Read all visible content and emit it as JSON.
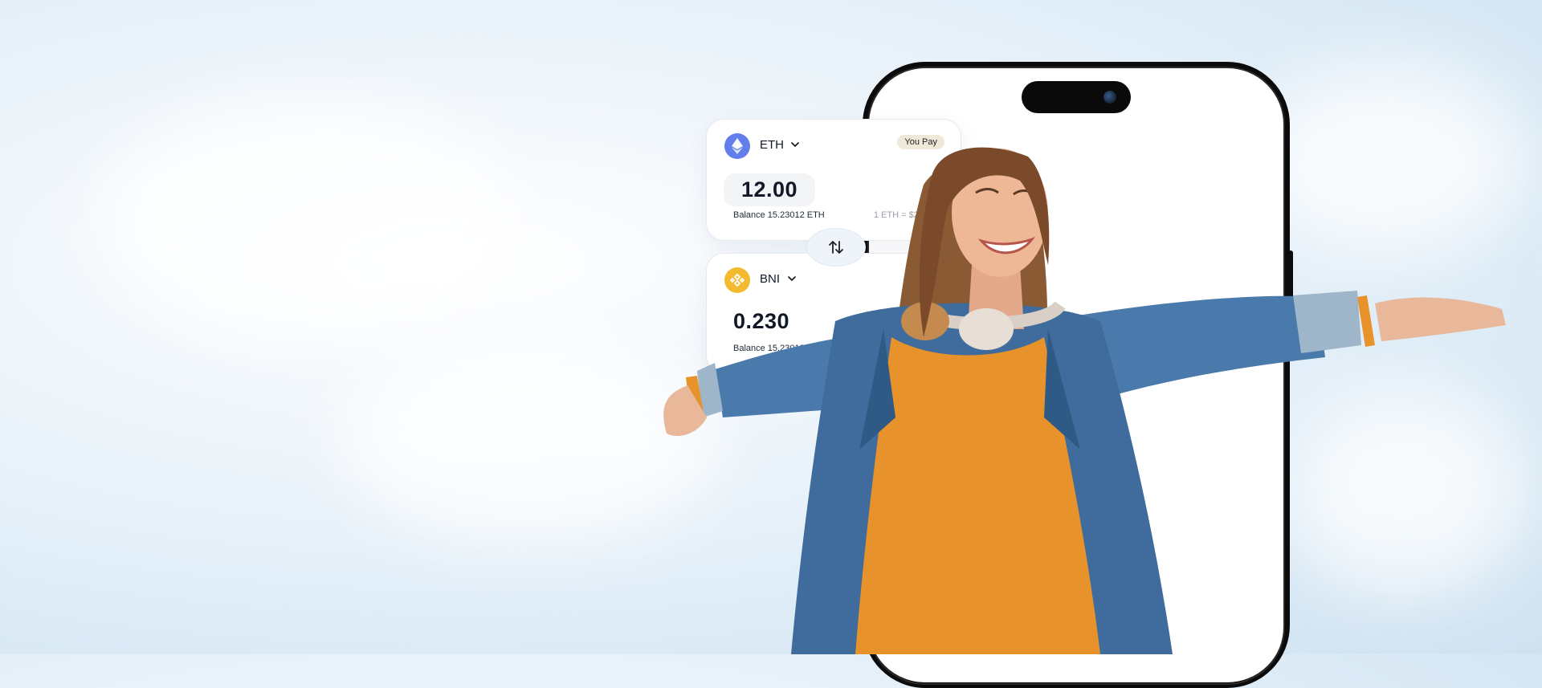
{
  "swap": {
    "pay": {
      "token": "ETH",
      "badge": "You Pay",
      "amount": "12.00",
      "balance": "Balance 15.23012 ETH",
      "rate": "1 ETH = $24"
    },
    "receive": {
      "token": "BNI",
      "amount": "0.230",
      "balance": "Balance 15.23012"
    },
    "swap_icon": "swap-arrows-icon"
  },
  "colors": {
    "eth": "#627eea",
    "bnb": "#f3ba2f",
    "jacket": "#3f6c9c",
    "shirt": "#e8922c"
  }
}
